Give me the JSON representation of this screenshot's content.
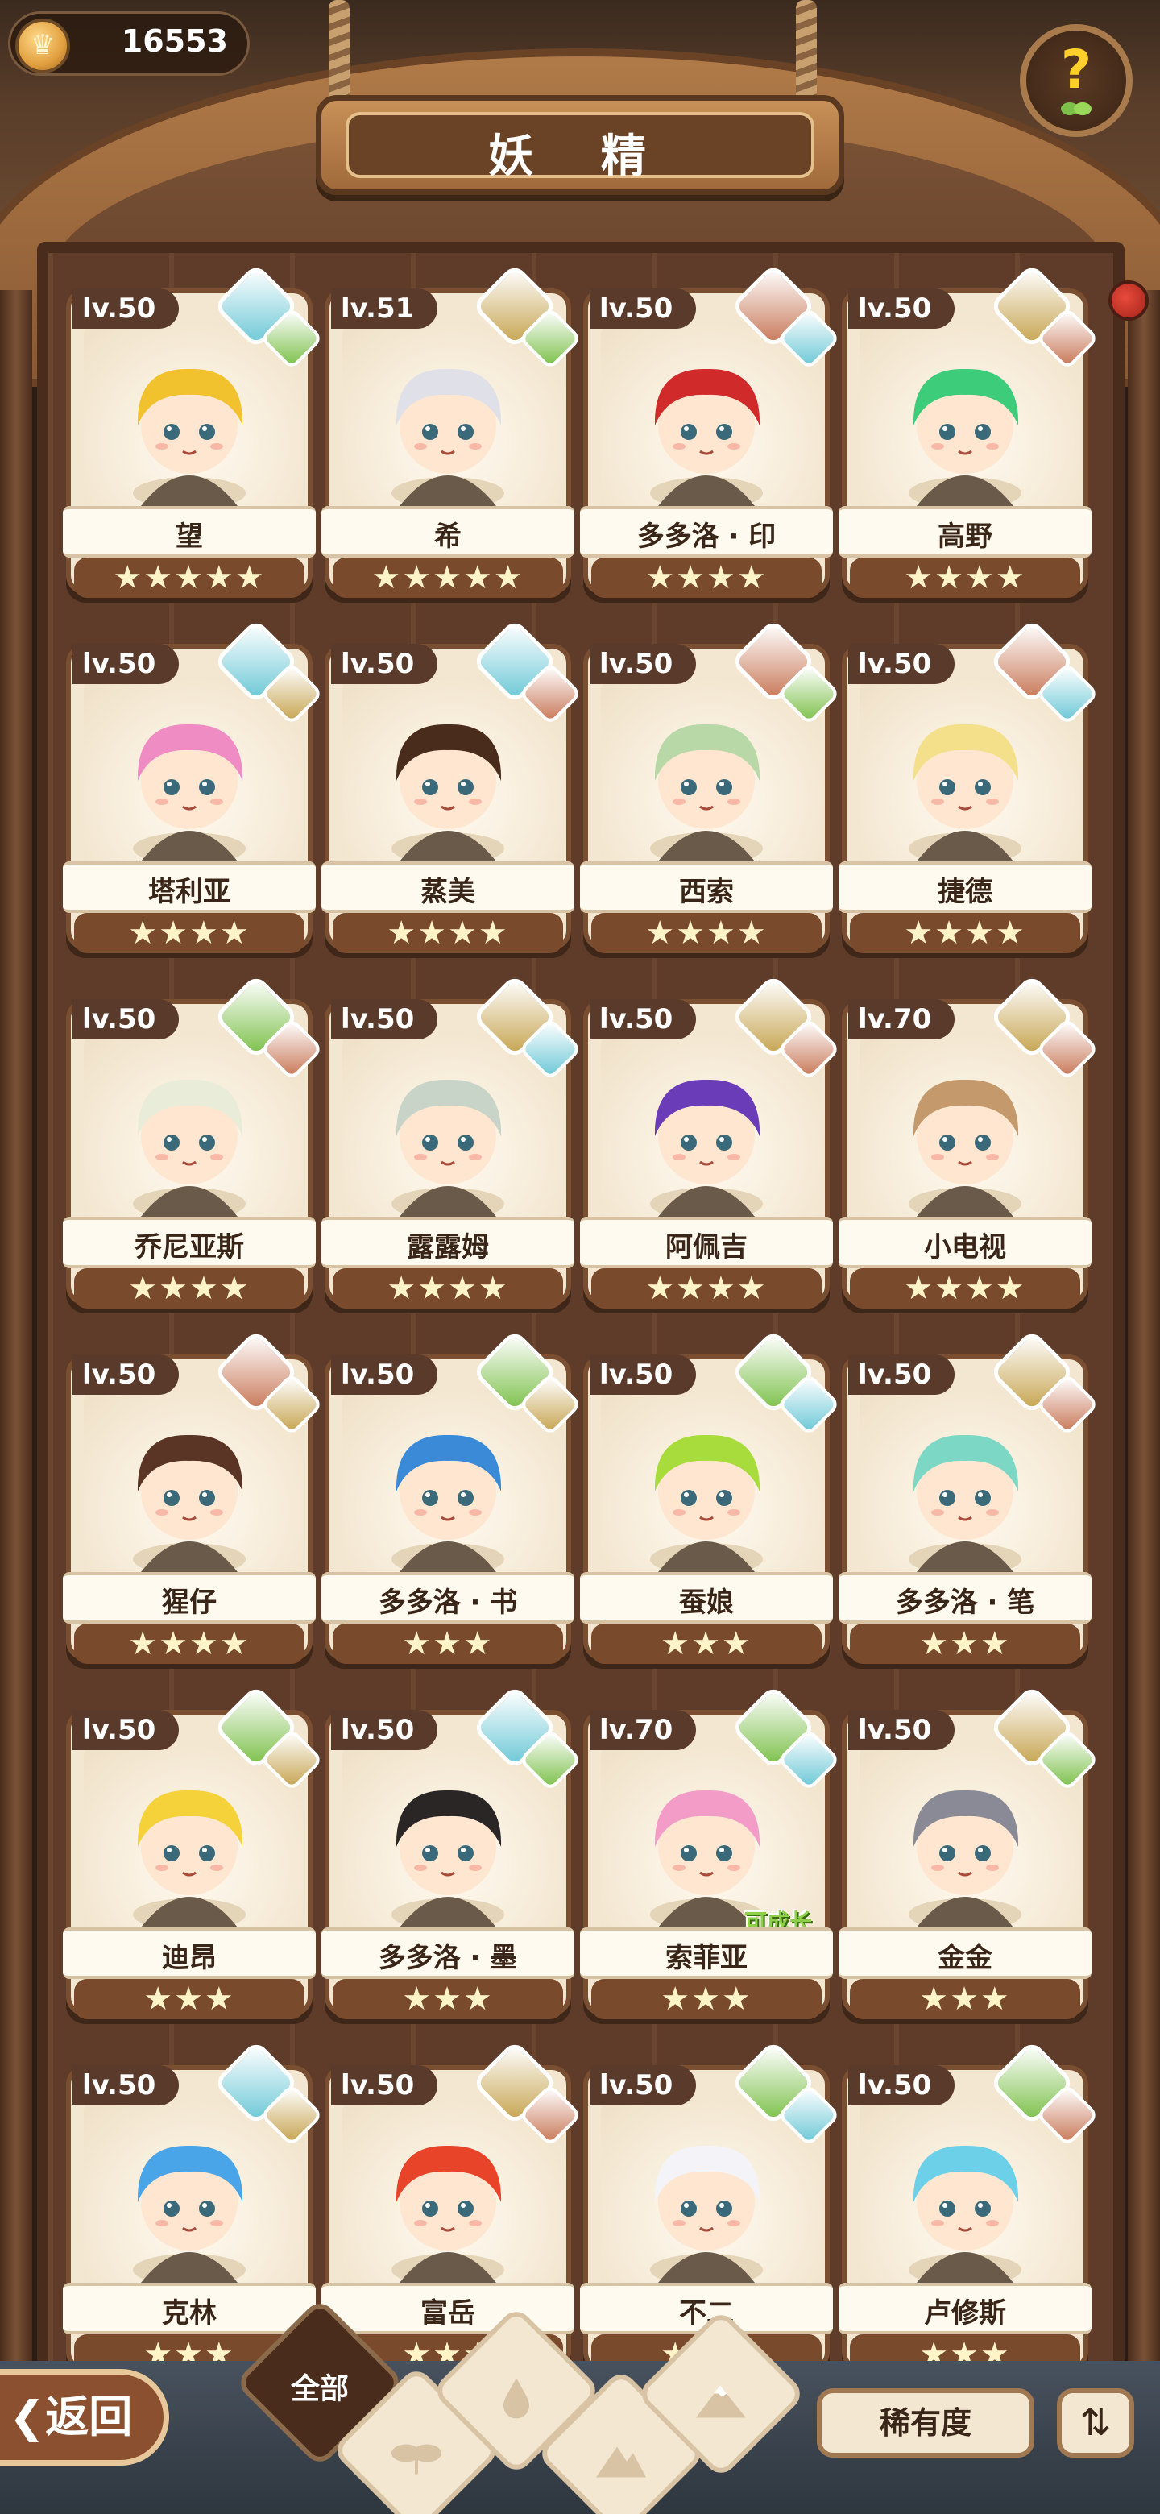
{
  "header": {
    "coins": "16553",
    "title": "妖 精"
  },
  "colors": {
    "water": "#6cc8d6",
    "plant": "#7cc04a",
    "earth": "#c6a450",
    "fire": "#c87858"
  },
  "cards": [
    {
      "level": "lv.50",
      "name": "望",
      "stars": "★★★★★",
      "gems": [
        "water",
        "plant"
      ],
      "hair": "#f2c12e"
    },
    {
      "level": "lv.51",
      "name": "希",
      "stars": "★★★★★",
      "gems": [
        "earth",
        "plant"
      ],
      "hair": "#dfe0e8"
    },
    {
      "level": "lv.50",
      "name": "多多洛 · 印",
      "stars": "★★★★",
      "gems": [
        "fire",
        "water"
      ],
      "hair": "#d02a2a"
    },
    {
      "level": "lv.50",
      "name": "高野",
      "stars": "★★★★",
      "gems": [
        "earth",
        "fire"
      ],
      "hair": "#3ccc7a"
    },
    {
      "level": "lv.50",
      "name": "塔利亚",
      "stars": "★★★★",
      "gems": [
        "water",
        "earth"
      ],
      "hair": "#f08cc4"
    },
    {
      "level": "lv.50",
      "name": "蒸美",
      "stars": "★★★★",
      "gems": [
        "water",
        "fire"
      ],
      "hair": "#4a2c1c"
    },
    {
      "level": "lv.50",
      "name": "西索",
      "stars": "★★★★",
      "gems": [
        "fire",
        "plant"
      ],
      "hair": "#b8d8a8"
    },
    {
      "level": "lv.50",
      "name": "捷德",
      "stars": "★★★★",
      "gems": [
        "fire",
        "water"
      ],
      "hair": "#f4e08a"
    },
    {
      "level": "lv.50",
      "name": "乔尼亚斯",
      "stars": "★★★★",
      "gems": [
        "plant",
        "fire"
      ],
      "hair": "#e8ecd8"
    },
    {
      "level": "lv.50",
      "name": "露露姆",
      "stars": "★★★★",
      "gems": [
        "earth",
        "water"
      ],
      "hair": "#c8d4c8"
    },
    {
      "level": "lv.50",
      "name": "阿佩吉",
      "stars": "★★★★",
      "gems": [
        "earth",
        "fire"
      ],
      "hair": "#6a3cb8"
    },
    {
      "level": "lv.70",
      "name": "小电视",
      "stars": "★★★★",
      "gems": [
        "earth",
        "fire"
      ],
      "hair": "#c49a6c"
    },
    {
      "level": "lv.50",
      "name": "猩仔",
      "stars": "★★★★",
      "gems": [
        "fire",
        "earth"
      ],
      "hair": "#5a3424"
    },
    {
      "level": "lv.50",
      "name": "多多洛 · 书",
      "stars": "★★★",
      "gems": [
        "plant",
        "earth"
      ],
      "hair": "#3a8ad8"
    },
    {
      "level": "lv.50",
      "name": "蚕娘",
      "stars": "★★★",
      "gems": [
        "plant",
        "water"
      ],
      "hair": "#a8dc3c"
    },
    {
      "level": "lv.50",
      "name": "多多洛 · 笔",
      "stars": "★★★",
      "gems": [
        "earth",
        "fire"
      ],
      "hair": "#7cd8c4"
    },
    {
      "level": "lv.50",
      "name": "迪昂",
      "stars": "★★★",
      "gems": [
        "plant",
        "earth"
      ],
      "hair": "#f6d23a"
    },
    {
      "level": "lv.50",
      "name": "多多洛 · 墨",
      "stars": "★★★",
      "gems": [
        "water",
        "plant"
      ],
      "hair": "#2a2626"
    },
    {
      "level": "lv.70",
      "name": "索菲亚",
      "stars": "★★★",
      "gems": [
        "plant",
        "water"
      ],
      "hair": "#f49cc8",
      "tag": "可成长"
    },
    {
      "level": "lv.50",
      "name": "金金",
      "stars": "★★★",
      "gems": [
        "earth",
        "plant"
      ],
      "hair": "#8a8a96"
    },
    {
      "level": "lv.50",
      "name": "克林",
      "stars": "★★★",
      "gems": [
        "water",
        "earth"
      ],
      "hair": "#4aa4e8"
    },
    {
      "level": "lv.50",
      "name": "富岳",
      "stars": "★★★",
      "gems": [
        "earth",
        "fire"
      ],
      "hair": "#e8442a"
    },
    {
      "level": "lv.50",
      "name": "不二",
      "stars": "★★★",
      "gems": [
        "plant",
        "water"
      ],
      "hair": "#f4f4f8"
    },
    {
      "level": "lv.50",
      "name": "卢修斯",
      "stars": "★★★",
      "gems": [
        "plant",
        "fire"
      ],
      "hair": "#6cd0e8"
    }
  ],
  "bottom": {
    "back": "返回",
    "all": "全部",
    "rarity": "稀有度",
    "sort_icon": "sort-icon"
  }
}
